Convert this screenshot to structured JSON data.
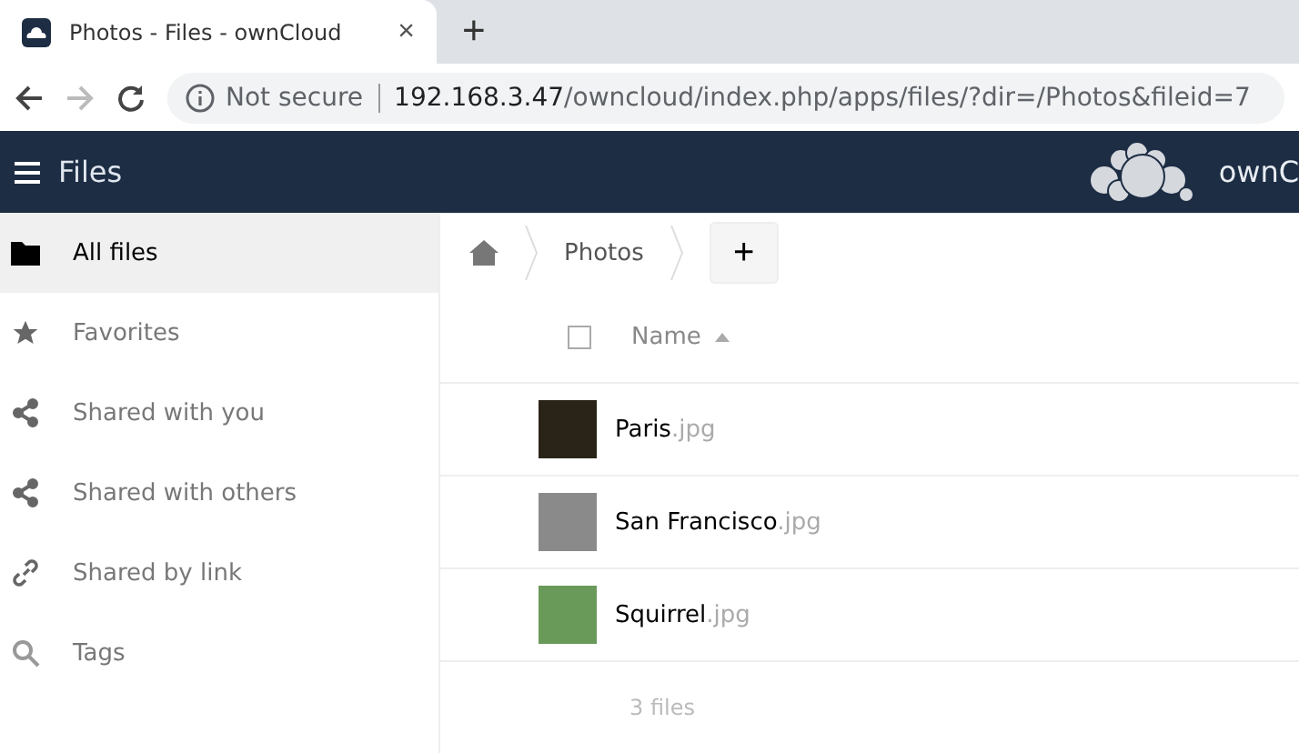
{
  "browser": {
    "tab": {
      "title": "Photos - Files - ownCloud",
      "close": "×"
    },
    "new_tab": "+",
    "security": "Not secure",
    "url_host": "192.168.3.47",
    "url_path": "/owncloud/index.php/apps/files/?dir=/Photos&fileid=7"
  },
  "header": {
    "title": "Files",
    "brand": "ownC"
  },
  "sidebar": {
    "items": [
      {
        "label": "All files",
        "kind": "folder",
        "selected": true
      },
      {
        "label": "Favorites",
        "kind": "star",
        "selected": false
      },
      {
        "label": "Shared with you",
        "kind": "share",
        "selected": false
      },
      {
        "label": "Shared with others",
        "kind": "share",
        "selected": false
      },
      {
        "label": "Shared by link",
        "kind": "link",
        "selected": false
      },
      {
        "label": "Tags",
        "kind": "search",
        "selected": false
      }
    ]
  },
  "breadcrumb": {
    "folder": "Photos",
    "add": "+"
  },
  "table": {
    "columns": [
      "Name"
    ],
    "select_all": {
      "checked": false
    },
    "rows": [
      {
        "name": "Paris",
        "ext": ".jpg",
        "color": "#2a2418"
      },
      {
        "name": "San Francisco",
        "ext": ".jpg",
        "color": "#8a8a8a"
      },
      {
        "name": "Squirrel",
        "ext": ".jpg",
        "color": "#6a9a5a"
      }
    ],
    "footer": "3 files"
  }
}
